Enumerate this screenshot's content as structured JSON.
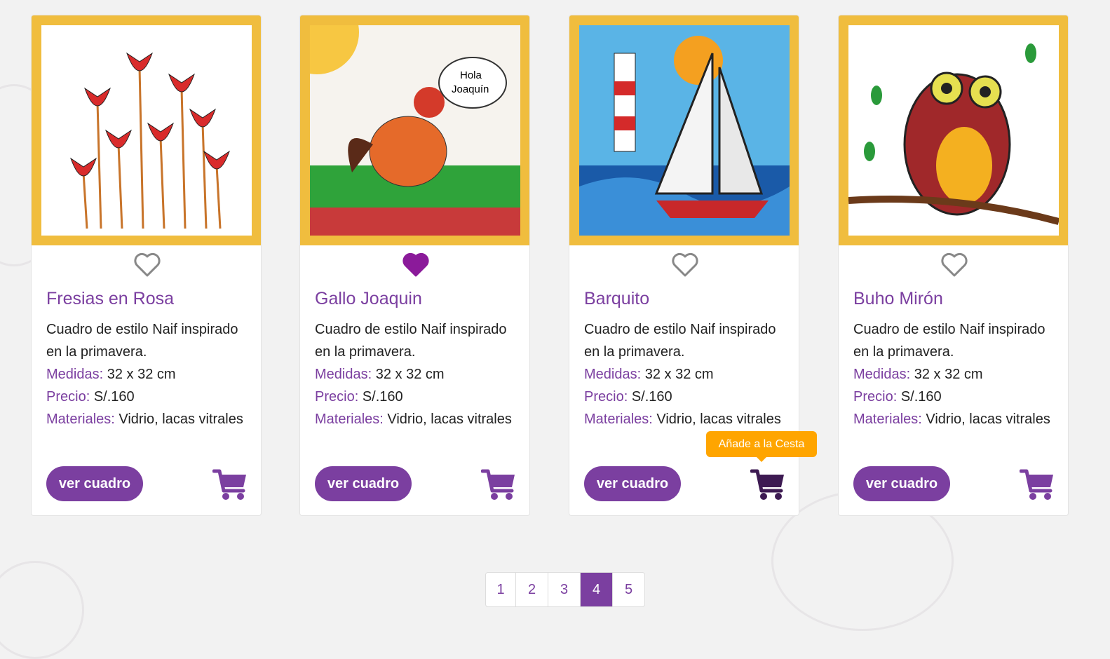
{
  "colors": {
    "accent": "#7b3fa0",
    "frame": "#f0bd3e",
    "tooltip": "#ffa500",
    "favorite": "#8b1a9a"
  },
  "products": [
    {
      "title": "Fresias en Rosa",
      "description": "Cuadro de estilo Naif inspirado en la primavera.",
      "medidas_label": "Medidas:",
      "medidas": "32 x 32 cm",
      "precio_label": "Precio:",
      "precio": "S/.160",
      "materiales_label": "Materiales:",
      "materiales": "Vidrio, lacas vitrales",
      "button": "ver cuadro",
      "favorite": false,
      "image": "red flowers painting"
    },
    {
      "title": "Gallo Joaquin",
      "description": "Cuadro de estilo Naif inspirado en la primavera.",
      "medidas_label": "Medidas:",
      "medidas": "32 x 32 cm",
      "precio_label": "Precio:",
      "precio": "S/.160",
      "materiales_label": "Materiales:",
      "materiales": "Vidrio, lacas vitrales",
      "button": "ver cuadro",
      "favorite": true,
      "image": "rooster painting",
      "image_text": "Hola Joaquín"
    },
    {
      "title": "Barquito",
      "description": "Cuadro de estilo Naif inspirado en la primavera.",
      "medidas_label": "Medidas:",
      "medidas": "32 x 32 cm",
      "precio_label": "Precio:",
      "precio": "S/.160",
      "materiales_label": "Materiales:",
      "materiales": "Vidrio, lacas vitrales",
      "button": "ver cuadro",
      "favorite": false,
      "image": "sailboat and lighthouse painting"
    },
    {
      "title": "Buho Mirón",
      "description": "Cuadro de estilo Naif inspirado en la primavera.",
      "medidas_label": "Medidas:",
      "medidas": "32 x 32 cm",
      "precio_label": "Precio:",
      "precio": "S/.160",
      "materiales_label": "Materiales:",
      "materiales": "Vidrio, lacas vitrales",
      "button": "ver cuadro",
      "favorite": false,
      "image": "owl painting"
    }
  ],
  "tooltip": "Añade a la Cesta",
  "pagination": {
    "pages": [
      "1",
      "2",
      "3",
      "4",
      "5"
    ],
    "current": "4"
  }
}
